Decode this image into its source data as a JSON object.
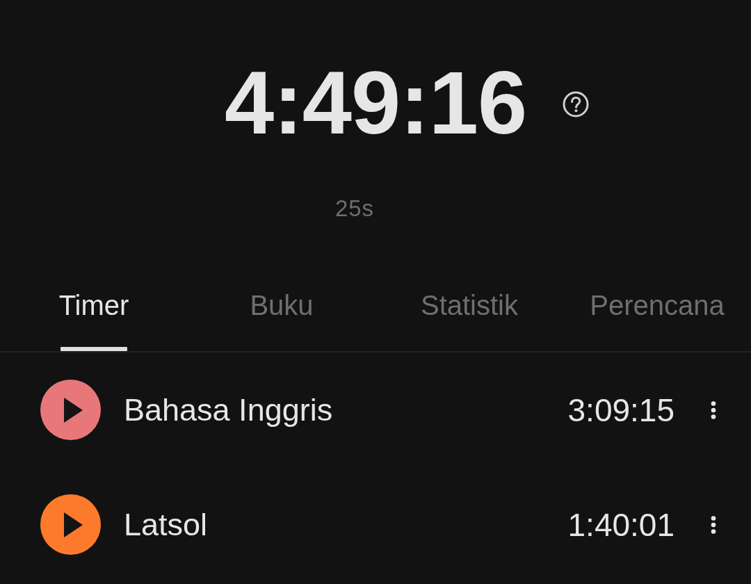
{
  "clock": {
    "total": "4:49:16",
    "session": "25s"
  },
  "tabs": [
    {
      "label": "Timer",
      "selected": true
    },
    {
      "label": "Buku",
      "selected": false
    },
    {
      "label": "Statistik",
      "selected": false
    },
    {
      "label": "Perencana",
      "selected": false
    }
  ],
  "timers": [
    {
      "name": "Bahasa Inggris",
      "time": "3:09:15",
      "color": "#e8777a"
    },
    {
      "name": "Latsol",
      "time": "1:40:01",
      "color": "#fd7a2c"
    }
  ]
}
